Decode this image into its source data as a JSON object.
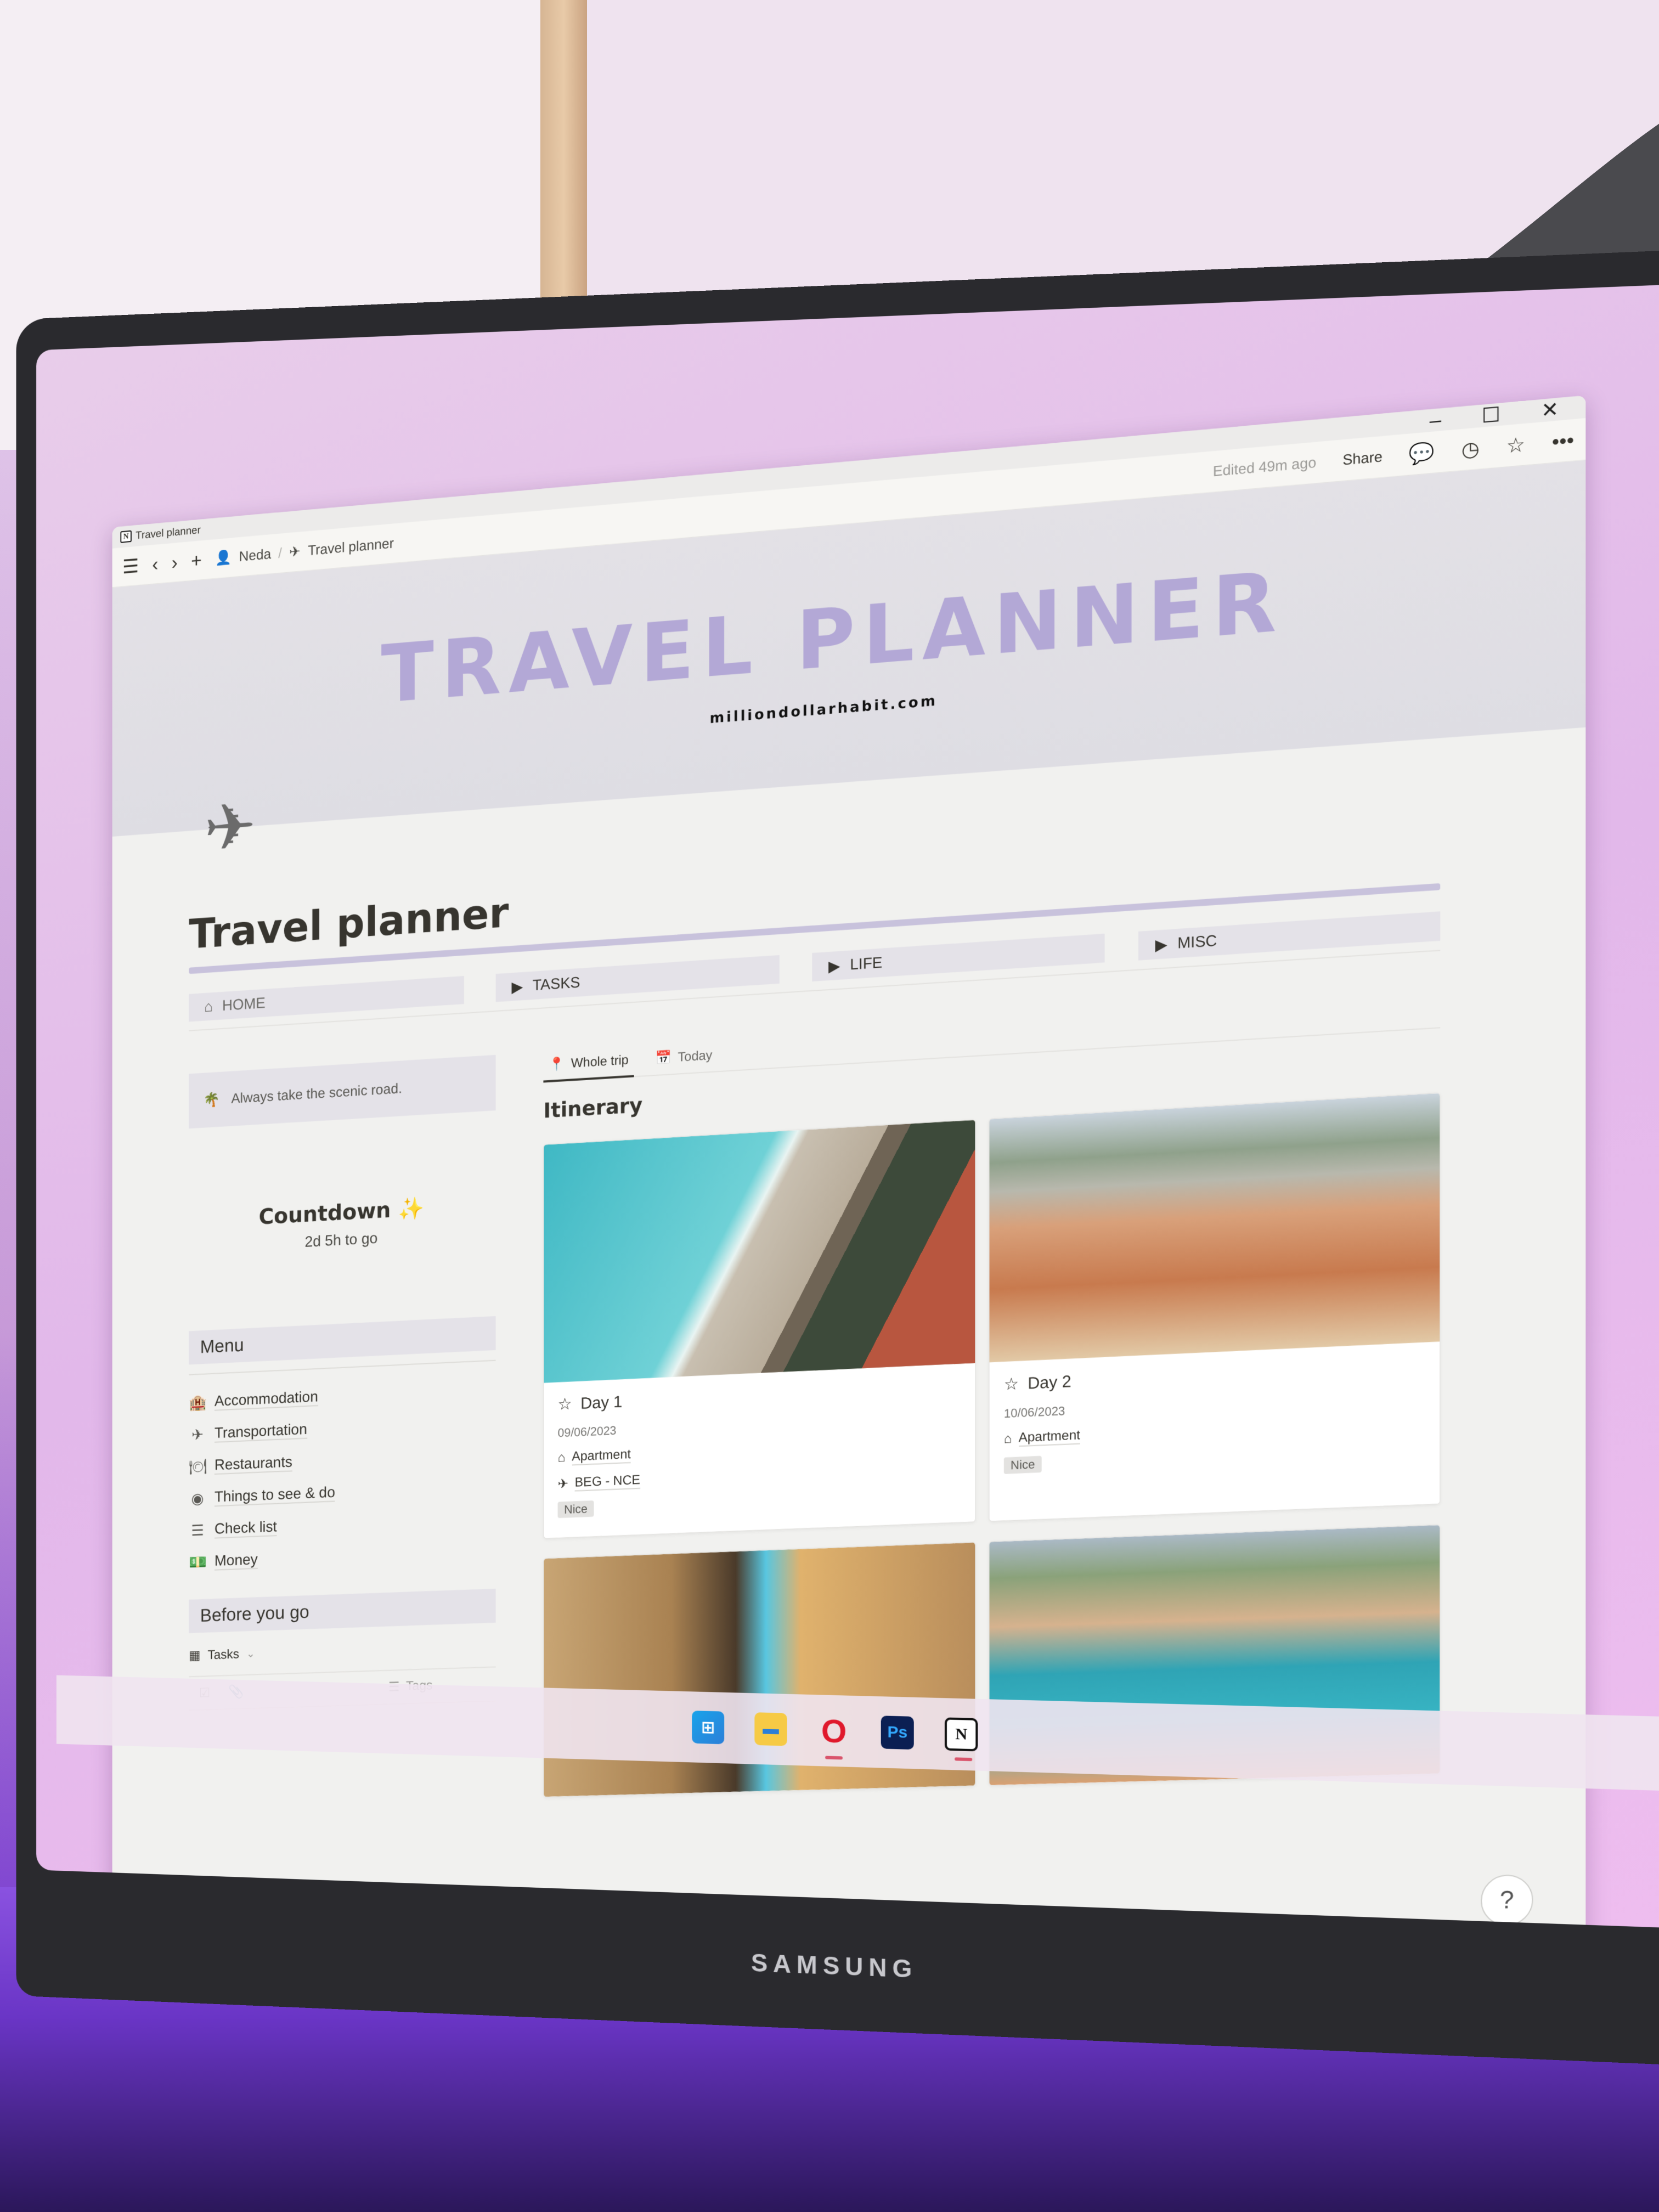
{
  "window": {
    "tab_title": "Travel planner",
    "controls": {
      "minimize": "–",
      "maximize": "☐",
      "close": "✕"
    }
  },
  "topbar": {
    "breadcrumb": [
      {
        "icon": "user-avatar-icon",
        "label": "Neda"
      },
      {
        "icon": "airplane-icon",
        "label": "Travel planner"
      }
    ],
    "separator": "/",
    "edited": "Edited 49m ago",
    "share_label": "Share",
    "icons": [
      "comments-icon",
      "history-clock-icon",
      "favorite-star-icon",
      "more-dots-icon"
    ]
  },
  "cover": {
    "title": "TRAVEL PLANNER",
    "subtitle": "milliondollarhabit.com",
    "accent_color": "#b3a8d6"
  },
  "page": {
    "icon": "airplane-icon",
    "title": "Travel planner"
  },
  "nav": [
    {
      "icon": "home-icon",
      "label": "HOME"
    },
    {
      "icon": "toggle-triangle-icon",
      "label": "TASKS"
    },
    {
      "icon": "toggle-triangle-icon",
      "label": "LIFE"
    },
    {
      "icon": "toggle-triangle-icon",
      "label": "MISC"
    }
  ],
  "sidebar": {
    "callout": {
      "icon": "palm-tree-icon",
      "text": "Always take the scenic road."
    },
    "countdown": {
      "title": "Countdown",
      "emoji": "✨",
      "remaining": "2d 5h to go"
    },
    "menu": {
      "heading": "Menu",
      "items": [
        {
          "icon": "building-icon",
          "label": "Accommodation"
        },
        {
          "icon": "airplane-icon",
          "label": "Transportation"
        },
        {
          "icon": "dining-icon",
          "label": "Restaurants"
        },
        {
          "icon": "eye-icon",
          "label": "Things to see & do"
        },
        {
          "icon": "list-icon",
          "label": "Check list"
        },
        {
          "icon": "money-icon",
          "label": "Money"
        }
      ]
    },
    "before_you_go": {
      "heading": "Before you go",
      "view_label": "Tasks",
      "columns": {
        "tags": "Tags"
      }
    }
  },
  "itinerary": {
    "tabs": [
      {
        "icon": "map-pin-icon",
        "label": "Whole trip",
        "active": true
      },
      {
        "icon": "calendar-icon",
        "label": "Today",
        "active": false
      }
    ],
    "heading": "Itinerary",
    "cards": [
      {
        "name": "Day 1",
        "date": "09/06/2023",
        "accommodation": "Apartment",
        "transport": "BEG - NCE",
        "tag": "Nice",
        "image": "beach"
      },
      {
        "name": "Day 2",
        "date": "10/06/2023",
        "accommodation": "Apartment",
        "transport": null,
        "tag": "Nice",
        "image": "city"
      },
      {
        "name": "",
        "image": "alley"
      },
      {
        "name": "",
        "image": "port"
      }
    ]
  },
  "help_label": "?",
  "taskbar": {
    "apps": [
      {
        "name": "start",
        "glyph": "⊞"
      },
      {
        "name": "file-explorer",
        "glyph": "▬"
      },
      {
        "name": "opera",
        "glyph": "O",
        "running": true
      },
      {
        "name": "photoshop",
        "glyph": "Ps"
      },
      {
        "name": "notion",
        "glyph": "N",
        "running": true
      }
    ]
  },
  "monitor_brand": "SAMSUNG"
}
